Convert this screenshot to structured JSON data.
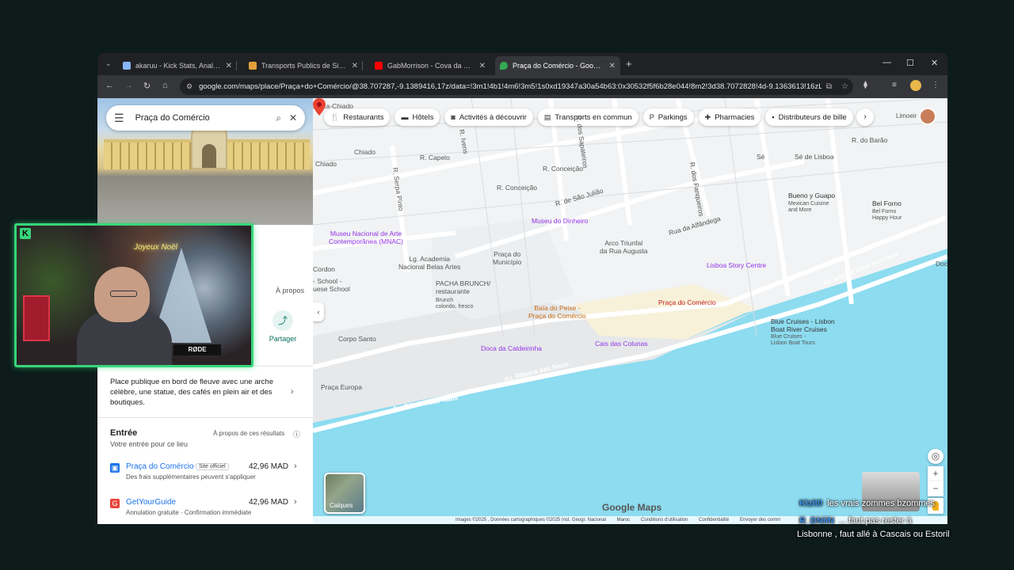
{
  "browser": {
    "tabs": [
      {
        "title": "akaruu - Kick Stats, Analytics an",
        "favicon": "#8ab4f8"
      },
      {
        "title": "Transports Publics de Sintra, Po",
        "favicon": "#e2a03b"
      },
      {
        "title": "GabMorrison - Cova da Moura",
        "favicon": "#ff0000"
      },
      {
        "title": "Praça do Comércio - Google M",
        "favicon": "#34a853"
      }
    ],
    "url": "google.com/maps/place/Praça+do+Comércio/@38.707287,-9.1389416,17z/data=!3m1!4b1!4m6!3m5!1s0xd19347a30a54b63:0x30532f5f6b28e044!8m2!3d38.7072828!4d-9.1363613!16zL..."
  },
  "sidebar": {
    "search_value": "Praça do Comércio",
    "a_propos": "À propos",
    "partager": "Partager",
    "partial_r": "r",
    "partial_n": "n",
    "partial_e": "e",
    "description": "Place publique en bord de fleuve avec une arche célèbre, une statue, des cafés en plein air et des boutiques.",
    "entree_title": "Entrée",
    "entree_results": "À propos de ces résultats",
    "entree_sub": "Votre entrée pour ce lieu",
    "offers": [
      {
        "name": "Praça do Comércio",
        "badge": "Site officiel",
        "price": "42,96 MAD",
        "note": "Des frais supplémentaires peuvent s'appliquer",
        "icon_color": "#1a73e8"
      },
      {
        "name": "GetYourGuide",
        "badge": "",
        "price": "42,96 MAD",
        "note": "Annulation gratuite · Confirmation immédiate",
        "icon_color": "#e8453c"
      }
    ]
  },
  "map": {
    "chips": [
      "Restaurants",
      "Hôtels",
      "Activités à découvrir",
      "Transports en commun",
      "Parkings",
      "Pharmacies",
      "Distributeurs de bille"
    ],
    "labels": {
      "baixa_chiado": "Baixa-Chiado",
      "chiado1": "Chiado",
      "chiado2": "Chiado",
      "r_capelo": "R. Capelo",
      "r_ivens": "R. Ivens",
      "r_serpa_pinto": "R. Serpa Pinto",
      "r_conceicao1": "R. Conceição",
      "r_conceicao2": "R. Conceição",
      "r_sao_juliao": "R. de São Julião",
      "r_sapateiros": "R. dos Sapateiros",
      "r_fanqueiros": "R. dos Fanqueiros",
      "rua_alfandega": "Rua da Alfândega",
      "r_barao": "R. do Barão",
      "se": "Sé",
      "se_lisboa": "Sé de Lisboa",
      "museu_dinheiro": "Museu do Dinheiro",
      "arco_triunfal": "Arco Triunfal\nda Rua Augusta",
      "museu_mnac": "Museu Nacional de Arte\nContemporânea (MNAC)",
      "lg_academia": "Lg. Academia\nNacional Belas Artes",
      "praca_municipio": "Praça do\nMunicípio",
      "cordon": "Cordon",
      "school": "- School -\nuese School",
      "pacha": "PACHA BRUNCH/\nrestaurante",
      "pacha_sub": "Brunch\ncolorido, fresco",
      "baia_peixe": "Baía do Peixe -\nPraça do Comércio",
      "praca_comercio": "Praça do Comércio",
      "lisboa_story": "Lisboa Story Centre",
      "bueno_guapo": "Bueno y Guapo",
      "bueno_sub": "Mexican Cuisine\nand More",
      "bel_forno": "Bel Forno",
      "bel_forno_sub": "Bel Forno\nHappy Hour",
      "corpo_santo": "Corpo Santo",
      "doca_caldeirinha": "Doca da Caldeirinha",
      "cais_colunas": "Cais das Colunas",
      "blue_cruises": "Blue Cruises - Lisbon\nBoat River Cruises",
      "blue_sub": "Blue Cruises -\nLisbon Boat Tours",
      "av_infante": "Av. Infante Dom Henrique",
      "av_ribeira": "Av. Ribeira das Naus",
      "av_ribeira2": "Av. Ribeira das Naus",
      "praca_europa": "Praça Europa",
      "limoeiro": "Limoeir",
      "doc": "Doc"
    },
    "calques": "Calques",
    "google_maps": "Google Maps",
    "attribution": [
      "Images ©2025 , Données cartographiques ©2025 Inst. Geogr. Nacional",
      "Maroc",
      "Conditions d'utilisation",
      "Confidentialité",
      "Envoyer des comm"
    ]
  },
  "stream": {
    "sign": "Joyeux Noël",
    "mic_brand": "RØDE",
    "chat": [
      {
        "user": "Kizit0",
        "message": "les vrais zommes bzommes"
      },
      {
        "user": "R_DNiiN",
        "message": "... faut pas rester à"
      },
      {
        "user": "",
        "message": "Lisbonne , faut allé à Cascais ou Estoril"
      }
    ]
  }
}
